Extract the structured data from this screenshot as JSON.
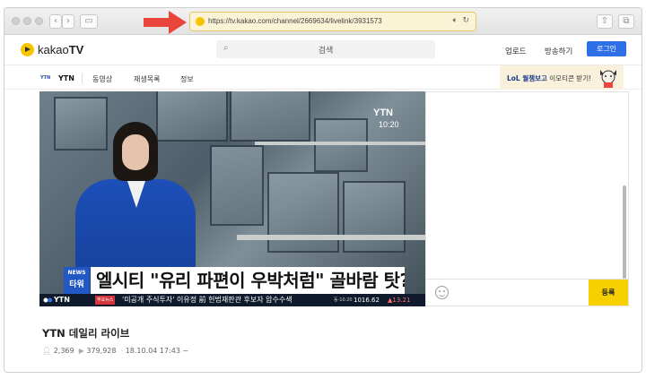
{
  "browser": {
    "url": "https://tv.kakao.com/channel/2669634/livelink/3931573",
    "speaker_icon": "speaker-icon",
    "reload_icon": "reload-icon",
    "back_icon": "chevron-left-icon",
    "forward_icon": "chevron-right-icon",
    "sidebar_icon": "sidebar-icon",
    "share_icon": "share-icon",
    "tabs_icon": "tabs-icon",
    "highlight_color": "#e6c66b",
    "arrow_color": "#e8453c"
  },
  "header": {
    "logo_brand": "kakao",
    "logo_suffix": "TV",
    "search_placeholder": "검색",
    "upload": "업로드",
    "broadcast": "방송하기",
    "login": "로그인",
    "login_color": "#2f70e8"
  },
  "channel_nav": {
    "channel_logo": "YTN",
    "items": [
      {
        "label": "YTN",
        "active": true
      },
      {
        "label": "동영상",
        "active": false
      },
      {
        "label": "재생목록",
        "active": false
      },
      {
        "label": "정보",
        "active": false
      }
    ],
    "promo_highlight": "LoL 월챔보고",
    "promo_rest": " 이모티콘 받기!"
  },
  "video": {
    "watermark": "YTN",
    "time": "10:20",
    "news_box_top": "NEWS",
    "news_box_bottom": "타워",
    "headline": "엘시티 \"유리 파편이 우박처럼\" 골바람 탓?",
    "ticker_logo": "YTN",
    "ticker_tag": "주요뉴스",
    "ticker_text": "'미공개 주식투자' 이유정 前 헌법재판관 후보자 압수수색",
    "ticker_index_label": "동·10:20",
    "ticker_index_value": "1016.62",
    "ticker_index_change": "▲13.21"
  },
  "chat": {
    "send_label": "등록",
    "send_color": "#f7d000"
  },
  "info": {
    "title": "YTN 데일리 라이브",
    "viewers": "2,369",
    "plays": "379,928",
    "date": "18.10.04 17:43 ~"
  }
}
